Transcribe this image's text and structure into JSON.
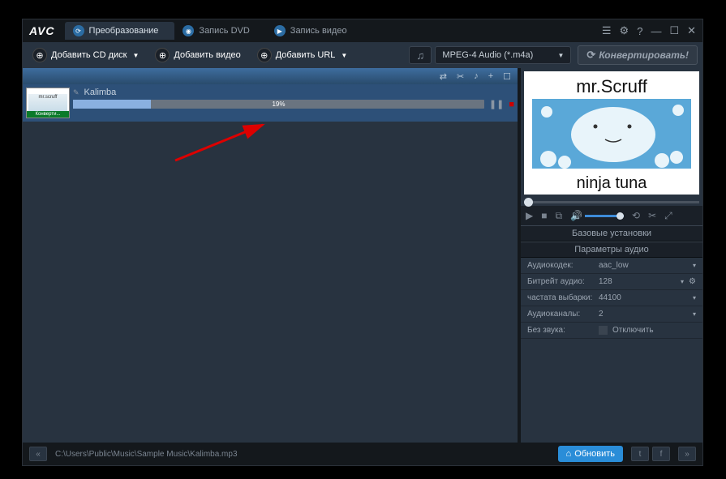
{
  "app": {
    "logo": "AVC"
  },
  "tabs": [
    {
      "label": "Преобразование",
      "active": true
    },
    {
      "label": "Запись DVD",
      "active": false
    },
    {
      "label": "Запись видео",
      "active": false
    }
  ],
  "toolbar": {
    "add_cd": "Добавить CD диск",
    "add_video": "Добавить видео",
    "add_url": "Добавить URL",
    "format": "MPEG-4 Audio (*.m4a)",
    "convert": "Конвертировать!"
  },
  "list_actions": {
    "add": "+"
  },
  "item": {
    "title": "Kalimba",
    "thumb_top": "mr.scruff",
    "thumb_status": "Конверти...",
    "progress_pct": 19,
    "progress_label": "19%"
  },
  "art_text": {
    "top": "mr.Scruff",
    "bottom": "ninja tuna"
  },
  "sections": {
    "basic": "Базовые установки",
    "audio_params": "Параметры аудио"
  },
  "params": [
    {
      "label": "Аудиокодек:",
      "value": "aac_low",
      "gear": false
    },
    {
      "label": "Битрейт аудио:",
      "value": "128",
      "gear": true
    },
    {
      "label": "частата выбарки:",
      "value": "44100",
      "gear": false
    },
    {
      "label": "Аудиоканалы:",
      "value": "2",
      "gear": false
    }
  ],
  "mute": {
    "label": "Без звука:",
    "check_label": "Отключить"
  },
  "status": {
    "path": "C:\\Users\\Public\\Music\\Sample Music\\Kalimba.mp3",
    "update": "Обновить"
  }
}
